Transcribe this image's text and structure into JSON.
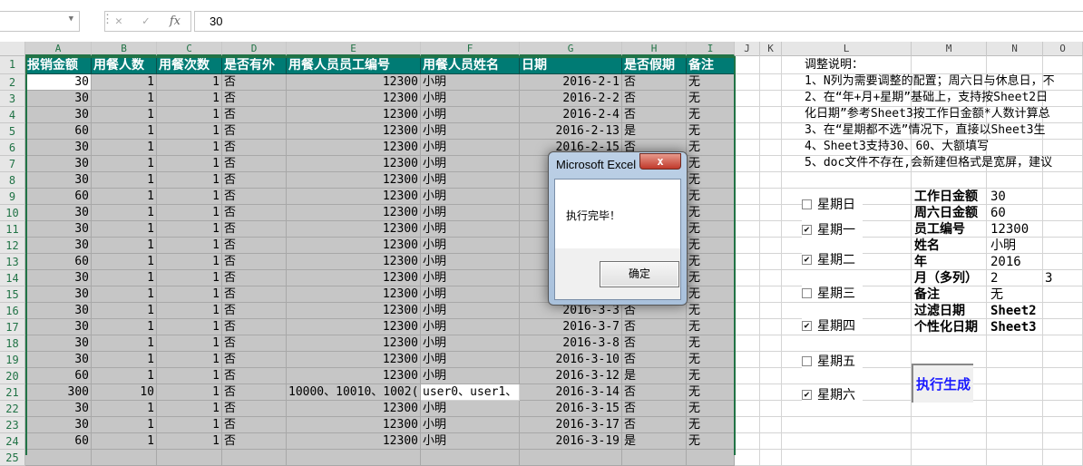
{
  "formula_bar": {
    "name_box": "",
    "cancel_icon": "✕",
    "enter_icon": "✓",
    "fx_label": "fx",
    "value": "30"
  },
  "columns": [
    "A",
    "B",
    "C",
    "D",
    "E",
    "F",
    "G",
    "H",
    "I",
    "J",
    "K",
    "L",
    "M",
    "N",
    "O"
  ],
  "header_row": [
    "报销金额",
    "用餐人数",
    "用餐次数",
    "是否有外",
    "用餐人员员工编号",
    "用餐人员姓名",
    "日期",
    "是否假期",
    "备注"
  ],
  "rows": [
    [
      "30",
      "1",
      "1",
      "否",
      "12300",
      "小明",
      "2016-2-1",
      "否",
      "无"
    ],
    [
      "30",
      "1",
      "1",
      "否",
      "12300",
      "小明",
      "2016-2-2",
      "否",
      "无"
    ],
    [
      "30",
      "1",
      "1",
      "否",
      "12300",
      "小明",
      "2016-2-4",
      "否",
      "无"
    ],
    [
      "60",
      "1",
      "1",
      "否",
      "12300",
      "小明",
      "2016-2-13",
      "是",
      "无"
    ],
    [
      "30",
      "1",
      "1",
      "否",
      "12300",
      "小明",
      "2016-2-15",
      "否",
      "无"
    ],
    [
      "30",
      "1",
      "1",
      "否",
      "12300",
      "小明",
      "",
      "",
      "无"
    ],
    [
      "30",
      "1",
      "1",
      "否",
      "12300",
      "小明",
      "",
      "",
      "无"
    ],
    [
      "60",
      "1",
      "1",
      "否",
      "12300",
      "小明",
      "",
      "",
      "无"
    ],
    [
      "30",
      "1",
      "1",
      "否",
      "12300",
      "小明",
      "",
      "",
      "无"
    ],
    [
      "30",
      "1",
      "1",
      "否",
      "12300",
      "小明",
      "",
      "",
      "无"
    ],
    [
      "30",
      "1",
      "1",
      "否",
      "12300",
      "小明",
      "",
      "",
      "无"
    ],
    [
      "60",
      "1",
      "1",
      "否",
      "12300",
      "小明",
      "",
      "",
      "无"
    ],
    [
      "30",
      "1",
      "1",
      "否",
      "12300",
      "小明",
      "",
      "",
      "无"
    ],
    [
      "30",
      "1",
      "1",
      "否",
      "12300",
      "小明",
      "",
      "",
      "无"
    ],
    [
      "30",
      "1",
      "1",
      "否",
      "12300",
      "小明",
      "2016-3-3",
      "否",
      "无"
    ],
    [
      "30",
      "1",
      "1",
      "否",
      "12300",
      "小明",
      "2016-3-7",
      "否",
      "无"
    ],
    [
      "30",
      "1",
      "1",
      "否",
      "12300",
      "小明",
      "2016-3-8",
      "否",
      "无"
    ],
    [
      "30",
      "1",
      "1",
      "否",
      "12300",
      "小明",
      "2016-3-10",
      "否",
      "无"
    ],
    [
      "60",
      "1",
      "1",
      "否",
      "12300",
      "小明",
      "2016-3-12",
      "是",
      "无"
    ],
    [
      "300",
      "10",
      "1",
      "否",
      "10000、10010、1002(",
      "user0、user1、",
      "2016-3-14",
      "否",
      "无"
    ],
    [
      "30",
      "1",
      "1",
      "否",
      "12300",
      "小明",
      "2016-3-15",
      "否",
      "无"
    ],
    [
      "30",
      "1",
      "1",
      "否",
      "12300",
      "小明",
      "2016-3-17",
      "否",
      "无"
    ],
    [
      "60",
      "1",
      "1",
      "否",
      "12300",
      "小明",
      "2016-3-19",
      "是",
      "无"
    ]
  ],
  "notes": [
    "调整说明：",
    "1、N列为需要调整的配置；周六日与休息日，不",
    "2、在“年+月+星期”基础上，支持按Sheet2日",
    "化日期”参考Sheet3按工作日金额*人数计算总",
    "3、在“星期都不选”情况下，直接以Sheet3生",
    "4、Sheet3支持30、60、大额填写",
    "5、doc文件不存在,会新建但格式是宽屏，建议"
  ],
  "weekdays": [
    {
      "label": "星期日",
      "checked": false
    },
    {
      "label": "星期一",
      "checked": true
    },
    {
      "label": "星期二",
      "checked": true
    },
    {
      "label": "星期三",
      "checked": false
    },
    {
      "label": "星期四",
      "checked": true
    },
    {
      "label": "星期五",
      "checked": false
    },
    {
      "label": "星期六",
      "checked": true
    }
  ],
  "config": [
    {
      "key": "工作日金额",
      "value": "30",
      "extra": ""
    },
    {
      "key": "周六日金额",
      "value": "60",
      "extra": ""
    },
    {
      "key": "员工编号",
      "value": "12300",
      "extra": ""
    },
    {
      "key": "姓名",
      "value": "小明",
      "extra": ""
    },
    {
      "key": "年",
      "value": "2016",
      "extra": ""
    },
    {
      "key": "月（多列）",
      "value": "2",
      "extra": "3"
    },
    {
      "key": "备注",
      "value": "无",
      "extra": ""
    },
    {
      "key": "过滤日期",
      "value": "Sheet2",
      "extra": ""
    },
    {
      "key": "个性化日期",
      "value": "Sheet3",
      "extra": ""
    }
  ],
  "generate_button": "执行生成",
  "dialog": {
    "title": "Microsoft Excel",
    "close": "x",
    "message": "执行完毕！",
    "ok": "确定"
  },
  "colors": {
    "header_bg": "#007b74",
    "selection": "#217346",
    "button_text": "#1a1aff"
  }
}
